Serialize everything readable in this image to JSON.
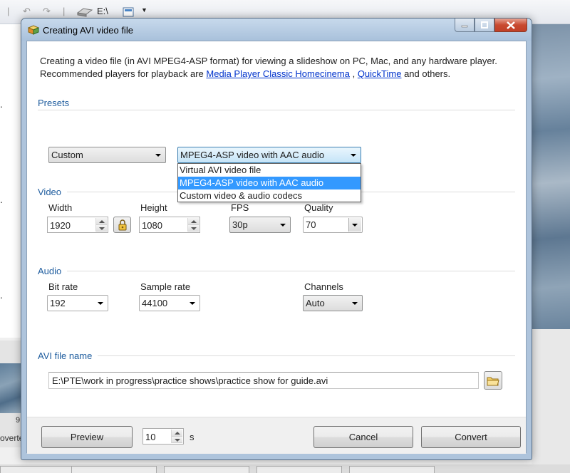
{
  "background": {
    "toolbar": {
      "path": "E:\\"
    },
    "thumb_number": "9",
    "thumb_caption": "overte"
  },
  "dialog": {
    "title": "Creating AVI video file",
    "intro_line1": "Creating a video file (in AVI MPEG4-ASP format) for viewing a slideshow on PC, Mac, and any hardware player.",
    "intro_line2_prefix": "Recommended players for playback are ",
    "link_mpc": "Media Player Classic Homecinema",
    "separator": " , ",
    "link_quicktime": "QuickTime",
    "intro_line2_suffix": " and others."
  },
  "presets": {
    "title": "Presets",
    "preset_value": "Custom",
    "format_value": "MPEG4-ASP video with AAC audio",
    "format_options": [
      {
        "label": "Virtual AVI video file",
        "selected": false
      },
      {
        "label": "MPEG4-ASP video with AAC audio",
        "selected": true
      },
      {
        "label": "Custom video & audio codecs",
        "selected": false
      }
    ]
  },
  "video": {
    "title": "Video",
    "width_label": "Width",
    "width_value": "1920",
    "height_label": "Height",
    "height_value": "1080",
    "fps_label": "FPS",
    "fps_value": "30p",
    "quality_label": "Quality",
    "quality_value": "70"
  },
  "audio": {
    "title": "Audio",
    "bitrate_label": "Bit rate",
    "bitrate_value": "192",
    "samplerate_label": "Sample rate",
    "samplerate_value": "44100",
    "channels_label": "Channels",
    "channels_value": "Auto"
  },
  "file": {
    "title": "AVI file name",
    "path": "E:\\PTE\\work in progress\\practice shows\\practice show for guide.avi"
  },
  "footer": {
    "preview_label": "Preview",
    "preview_seconds": "10",
    "seconds_unit": "s",
    "cancel_label": "Cancel",
    "convert_label": "Convert"
  },
  "colors": {
    "section_title": "#1e5c9e",
    "link": "#0033cc",
    "selection": "#3399ff",
    "close_button": "#c84a30"
  }
}
